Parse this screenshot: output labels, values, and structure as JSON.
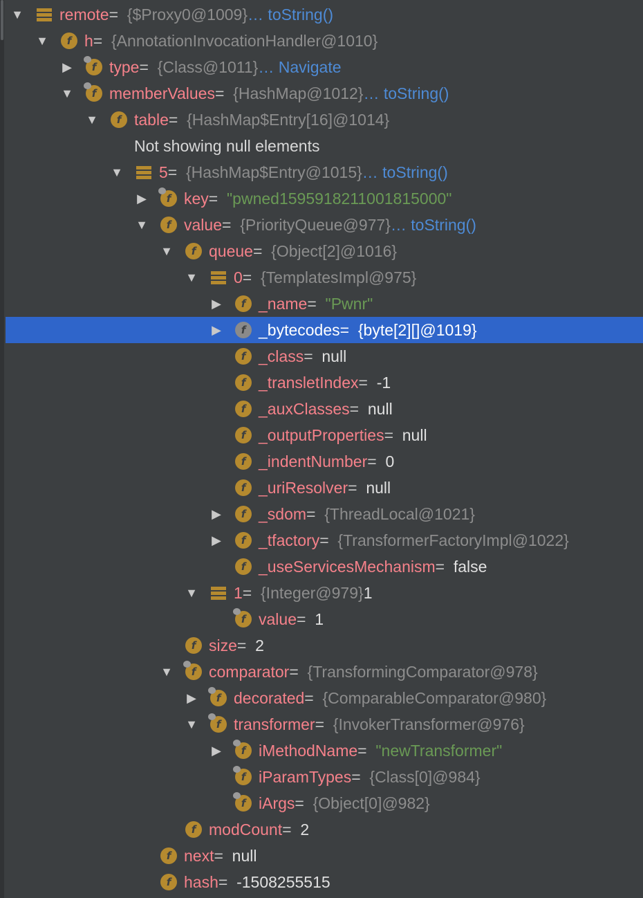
{
  "tree": {
    "nodes": [
      {
        "indent": 0,
        "arrow": "exp",
        "icon": "list",
        "name": "remote",
        "eq": " = ",
        "type": "{$Proxy0@1009}",
        "link": " … toString()"
      },
      {
        "indent": 1,
        "arrow": "exp",
        "icon": "field",
        "name": "h",
        "eq": " = ",
        "type": "{AnnotationInvocationHandler@1010}"
      },
      {
        "indent": 2,
        "arrow": "col",
        "icon": "field-lock",
        "name": "type",
        "eq": " = ",
        "type": "{Class@1011}",
        "link": " … Navigate"
      },
      {
        "indent": 2,
        "arrow": "exp",
        "icon": "field-lock",
        "name": "memberValues",
        "eq": " = ",
        "type": "{HashMap@1012}",
        "link": " … toString()"
      },
      {
        "indent": 3,
        "arrow": "exp",
        "icon": "field",
        "name": "table",
        "eq": " = ",
        "type": "{HashMap$Entry[16]@1014}"
      },
      {
        "indent": 4,
        "arrow": "none",
        "icon": "none",
        "plain": "Not showing null elements",
        "offset": -36
      },
      {
        "indent": 4,
        "arrow": "exp",
        "icon": "list",
        "name": "5",
        "eq": " = ",
        "type": "{HashMap$Entry@1015}",
        "link": " … toString()"
      },
      {
        "indent": 5,
        "arrow": "col",
        "icon": "field-lock",
        "name": "key",
        "eq": " = ",
        "str": "\"pwned1595918211001815000\""
      },
      {
        "indent": 5,
        "arrow": "exp",
        "icon": "field",
        "name": "value",
        "eq": " = ",
        "type": "{PriorityQueue@977}",
        "link": " … toString()"
      },
      {
        "indent": 6,
        "arrow": "exp",
        "icon": "field",
        "name": "queue",
        "eq": " = ",
        "type": "{Object[2]@1016}"
      },
      {
        "indent": 7,
        "arrow": "exp",
        "icon": "list",
        "name": "0",
        "eq": " = ",
        "type": "{TemplatesImpl@975}"
      },
      {
        "indent": 8,
        "arrow": "col",
        "icon": "field",
        "name": "_name",
        "eq": " = ",
        "str": "\"Pwnr\""
      },
      {
        "indent": 8,
        "arrow": "col",
        "icon": "field-gray",
        "name": "_bytecodes",
        "eq": " = ",
        "type": "{byte[2][]@1019}",
        "selected": true
      },
      {
        "indent": 8,
        "arrow": "none",
        "icon": "field",
        "name": "_class",
        "eq": " = ",
        "val": "null"
      },
      {
        "indent": 8,
        "arrow": "none",
        "icon": "field",
        "name": "_transletIndex",
        "eq": " = ",
        "val": "-1"
      },
      {
        "indent": 8,
        "arrow": "none",
        "icon": "field",
        "name": "_auxClasses",
        "eq": " = ",
        "val": "null"
      },
      {
        "indent": 8,
        "arrow": "none",
        "icon": "field",
        "name": "_outputProperties",
        "eq": " = ",
        "val": "null"
      },
      {
        "indent": 8,
        "arrow": "none",
        "icon": "field",
        "name": "_indentNumber",
        "eq": " = ",
        "val": "0"
      },
      {
        "indent": 8,
        "arrow": "none",
        "icon": "field",
        "name": "_uriResolver",
        "eq": " = ",
        "val": "null"
      },
      {
        "indent": 8,
        "arrow": "col",
        "icon": "field",
        "name": "_sdom",
        "eq": " = ",
        "type": "{ThreadLocal@1021}"
      },
      {
        "indent": 8,
        "arrow": "col",
        "icon": "field",
        "name": "_tfactory",
        "eq": " = ",
        "type": "{TransformerFactoryImpl@1022}"
      },
      {
        "indent": 8,
        "arrow": "none",
        "icon": "field",
        "name": "_useServicesMechanism",
        "eq": " = ",
        "val": "false"
      },
      {
        "indent": 7,
        "arrow": "exp",
        "icon": "list",
        "name": "1",
        "eq": " = ",
        "type": "{Integer@979}",
        "val": " 1"
      },
      {
        "indent": 8,
        "arrow": "none",
        "icon": "field-lock",
        "name": "value",
        "eq": " = ",
        "val": "1"
      },
      {
        "indent": 6,
        "arrow": "none",
        "icon": "field",
        "name": "size",
        "eq": " = ",
        "val": "2"
      },
      {
        "indent": 6,
        "arrow": "exp",
        "icon": "field-lock",
        "name": "comparator",
        "eq": " = ",
        "type": "{TransformingComparator@978}"
      },
      {
        "indent": 7,
        "arrow": "col",
        "icon": "field-lock",
        "name": "decorated",
        "eq": " = ",
        "type": "{ComparableComparator@980}"
      },
      {
        "indent": 7,
        "arrow": "exp",
        "icon": "field-lock",
        "name": "transformer",
        "eq": " = ",
        "type": "{InvokerTransformer@976}"
      },
      {
        "indent": 8,
        "arrow": "col",
        "icon": "field-lock",
        "name": "iMethodName",
        "eq": " = ",
        "str": "\"newTransformer\""
      },
      {
        "indent": 8,
        "arrow": "none",
        "icon": "field-lock",
        "name": "iParamTypes",
        "eq": " = ",
        "type": "{Class[0]@984}"
      },
      {
        "indent": 8,
        "arrow": "none",
        "icon": "field-lock",
        "name": "iArgs",
        "eq": " = ",
        "type": "{Object[0]@982}"
      },
      {
        "indent": 6,
        "arrow": "none",
        "icon": "field",
        "name": "modCount",
        "eq": " = ",
        "val": "2"
      },
      {
        "indent": 5,
        "arrow": "none",
        "icon": "field",
        "name": "next",
        "eq": " = ",
        "val": "null"
      },
      {
        "indent": 5,
        "arrow": "none",
        "icon": "field",
        "name": "hash",
        "eq": " = ",
        "val": "-1508255515"
      }
    ]
  },
  "colors": {
    "background": "#3c3f41",
    "selection": "#2f65ca",
    "field_name": "#f5818a",
    "type_text": "#8d8d8d",
    "link": "#4e8bd6",
    "string_value": "#6a9a55",
    "field_icon": "#b58a2f"
  }
}
